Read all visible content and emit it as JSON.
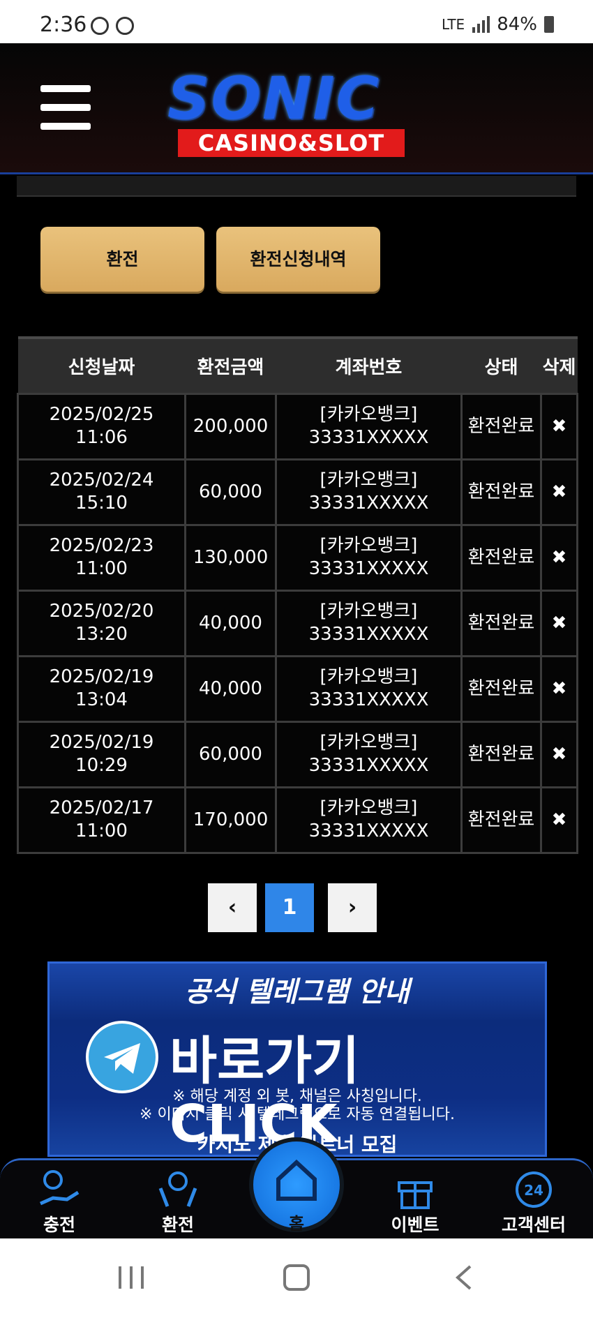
{
  "status_bar": {
    "time": "2:36",
    "network": "LTE",
    "battery": "84%"
  },
  "header": {
    "logo_main": "SONIC",
    "logo_sub": "CASINO&SLOT"
  },
  "actions": {
    "exchange": "환전",
    "history": "환전신청내역"
  },
  "table": {
    "headers": [
      "신청날짜",
      "환전금액",
      "계좌번호",
      "상태",
      "삭제"
    ],
    "rows": [
      {
        "date": "2025/02/25",
        "time": "11:06",
        "amount": "200,000",
        "bank": "[카카오뱅크]",
        "account": "33331XXXXX",
        "status": "환전완료"
      },
      {
        "date": "2025/02/24",
        "time": "15:10",
        "amount": "60,000",
        "bank": "[카카오뱅크]",
        "account": "33331XXXXX",
        "status": "환전완료"
      },
      {
        "date": "2025/02/23",
        "time": "11:00",
        "amount": "130,000",
        "bank": "[카카오뱅크]",
        "account": "33331XXXXX",
        "status": "환전완료"
      },
      {
        "date": "2025/02/20",
        "time": "13:20",
        "amount": "40,000",
        "bank": "[카카오뱅크]",
        "account": "33331XXXXX",
        "status": "환전완료"
      },
      {
        "date": "2025/02/19",
        "time": "13:04",
        "amount": "40,000",
        "bank": "[카카오뱅크]",
        "account": "33331XXXXX",
        "status": "환전완료"
      },
      {
        "date": "2025/02/19",
        "time": "10:29",
        "amount": "60,000",
        "bank": "[카카오뱅크]",
        "account": "33331XXXXX",
        "status": "환전완료"
      },
      {
        "date": "2025/02/17",
        "time": "11:00",
        "amount": "170,000",
        "bank": "[카카오뱅크]",
        "account": "33331XXXXX",
        "status": "환전완료"
      }
    ]
  },
  "pagination": {
    "current": "1",
    "prev": "‹",
    "next": "›"
  },
  "banner": {
    "title": "공식 텔레그램 안내",
    "cta": "바로가기 CLICK",
    "note1": "※ 해당 계정 외 봇, 채널은 사칭입니다.",
    "note2": "※ 이미지 클릭 시 텔레그램으로 자동 연결됩니다.",
    "recruit": "카지노 제휴 파트너 모집"
  },
  "bottom_nav": {
    "charge": "충전",
    "exchange": "환전",
    "home": "홈",
    "event": "이벤트",
    "support": "고객센터"
  },
  "colors": {
    "accent_gold": "#e4b86e",
    "link_blue": "#5aa5ff",
    "brand_blue": "#1f5fe8",
    "brand_red": "#e21b1b"
  }
}
